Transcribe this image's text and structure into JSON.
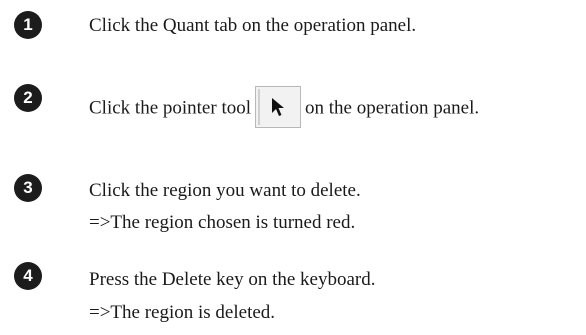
{
  "steps": [
    {
      "number": "1",
      "text": "Click the Quant tab on the operation panel."
    },
    {
      "number": "2",
      "text_before": "Click the pointer tool",
      "tool_icon": "pointer-arrow-icon",
      "text_after": "on the operation panel."
    },
    {
      "number": "3",
      "text": "Click the region you want to delete.",
      "result": "=>The region chosen is turned red."
    },
    {
      "number": "4",
      "text": "Press the Delete key on the keyboard.",
      "result": "=>The region is deleted."
    }
  ]
}
